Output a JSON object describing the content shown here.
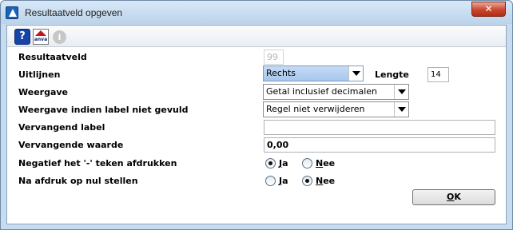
{
  "window": {
    "title": "Resultaatveld opgeven",
    "close_glyph": "✕"
  },
  "toolbar": {
    "help_glyph": "?",
    "anva_label": "anva",
    "info_glyph": "i",
    "icons": [
      "help-icon",
      "anva-icon",
      "info-icon"
    ]
  },
  "form": {
    "resultaatveld": {
      "label": "Resultaatveld",
      "value": "99"
    },
    "uitlijnen": {
      "label": "Uitlijnen",
      "value": "Rechts"
    },
    "lengte": {
      "label": "Lengte",
      "value": "14"
    },
    "weergave": {
      "label": "Weergave",
      "value": "Getal inclusief decimalen"
    },
    "weergave_label": {
      "label": "Weergave indien label niet gevuld",
      "value": "Regel niet verwijderen"
    },
    "vervangend_label": {
      "label": "Vervangend label",
      "value": ""
    },
    "vervangende_waarde": {
      "label": "Vervangende waarde",
      "value": "0,00"
    },
    "negatief": {
      "label": "Negatief het '-' teken afdrukken",
      "options": [
        {
          "key": "J",
          "rest": "a",
          "checked": true
        },
        {
          "key": "N",
          "rest": "ee",
          "checked": false
        }
      ]
    },
    "nul": {
      "label": "Na afdruk op nul stellen",
      "options": [
        {
          "key": "J",
          "rest": "a",
          "checked": false
        },
        {
          "key": "N",
          "rest": "ee",
          "checked": true
        }
      ]
    }
  },
  "buttons": {
    "ok_key": "O",
    "ok_rest": "K"
  },
  "colors": {
    "title_gradient_top": "#d9e8f7",
    "close_red": "#c9462e",
    "select_highlight": "#a7c7ec"
  }
}
